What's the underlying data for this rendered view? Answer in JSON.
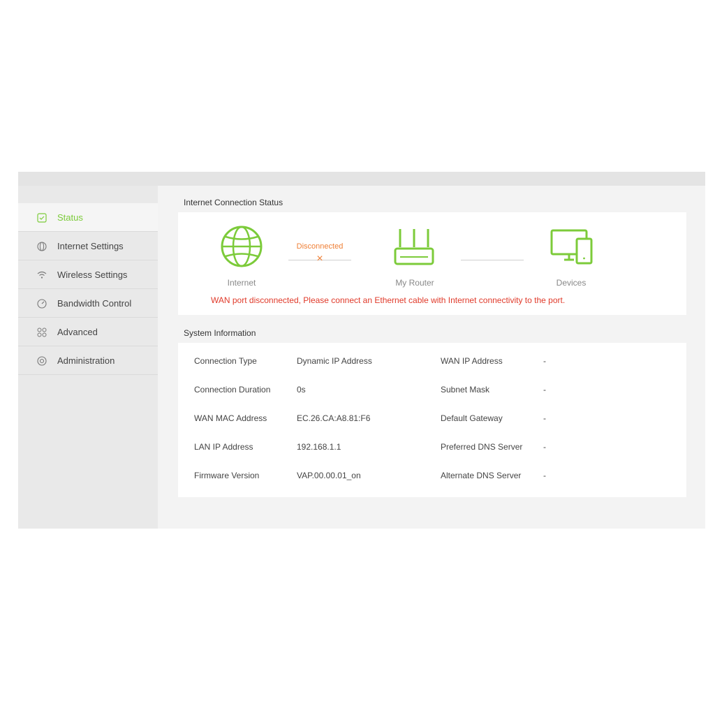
{
  "sidebar": {
    "items": [
      {
        "label": "Status",
        "icon": "status-icon",
        "active": true
      },
      {
        "label": "Internet Settings",
        "icon": "globe-icon",
        "active": false
      },
      {
        "label": "Wireless Settings",
        "icon": "wifi-icon",
        "active": false
      },
      {
        "label": "Bandwidth Control",
        "icon": "speedometer-icon",
        "active": false
      },
      {
        "label": "Advanced",
        "icon": "grid-icon",
        "active": false
      },
      {
        "label": "Administration",
        "icon": "admin-icon",
        "active": false
      }
    ]
  },
  "connection": {
    "title": "Internet Connection Status",
    "internet_label": "Internet",
    "router_label": "My Router",
    "devices_label": "Devices",
    "status": "Disconnected",
    "x_glyph": "×",
    "warning": "WAN port disconnected, Please connect an Ethernet cable with Internet connectivity to the port."
  },
  "system": {
    "title": "System Information",
    "left": [
      {
        "label": "Connection Type",
        "value": "Dynamic IP Address"
      },
      {
        "label": "Connection Duration",
        "value": "0s"
      },
      {
        "label": "WAN MAC Address",
        "value": "EC.26.CA:A8.81:F6"
      },
      {
        "label": "LAN IP Address",
        "value": "192.168.1.1"
      },
      {
        "label": "Firmware Version",
        "value": "VAP.00.00.01_on"
      }
    ],
    "right": [
      {
        "label": "WAN IP Address",
        "value": "-"
      },
      {
        "label": "Subnet Mask",
        "value": "-"
      },
      {
        "label": "Default Gateway",
        "value": "-"
      },
      {
        "label": "Preferred DNS Server",
        "value": "-"
      },
      {
        "label": "Alternate DNS Server",
        "value": "-"
      }
    ]
  },
  "colors": {
    "accent": "#7ccb3a",
    "warning": "#e03a2a",
    "disconnected": "#ef7f35"
  }
}
